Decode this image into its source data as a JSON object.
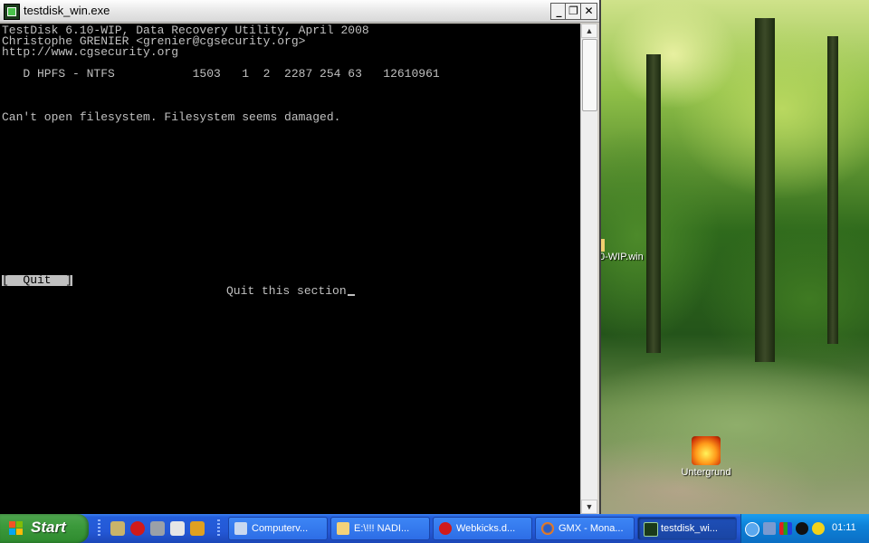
{
  "window": {
    "title": "testdisk_win.exe",
    "minimize_glyph": "_",
    "restore_glyph": "❐",
    "close_glyph": "✕"
  },
  "console": {
    "lines": [
      "TestDisk 6.10-WIP, Data Recovery Utility, April 2008",
      "Christophe GRENIER <grenier@cgsecurity.org>",
      "http://www.cgsecurity.org",
      "   D HPFS - NTFS           1503   1  2  2287 254 63   12610961",
      "Can't open filesystem. Filesystem seems damaged."
    ],
    "menu_option": "[  Quit  ]",
    "menu_help": "Quit this section"
  },
  "desktop": {
    "partial_icon_label": "0-WIP.win",
    "icons": [
      {
        "label": "Untergrund",
        "icon": "fire-icon"
      }
    ]
  },
  "taskbar": {
    "start_label": "Start",
    "quick_launch": [
      "eye-icon",
      "opera-icon",
      "tools-icon",
      "media-icon",
      "winamp-icon"
    ],
    "tasks": [
      {
        "label": "Computerv...",
        "icon": "computer-icon",
        "active": false
      },
      {
        "label": "E:\\!!! NADI...",
        "icon": "folder-icon",
        "active": false
      },
      {
        "label": "Webkicks.d...",
        "icon": "opera-icon",
        "active": false
      },
      {
        "label": "GMX - Mona...",
        "icon": "firefox-icon",
        "active": false
      },
      {
        "label": "testdisk_wi...",
        "icon": "console-icon",
        "active": true
      }
    ],
    "tray_icons": [
      "chevron-left-icon",
      "network-icon",
      "color-icon",
      "moon-icon",
      "skype-icon"
    ],
    "clock": "01:11"
  }
}
